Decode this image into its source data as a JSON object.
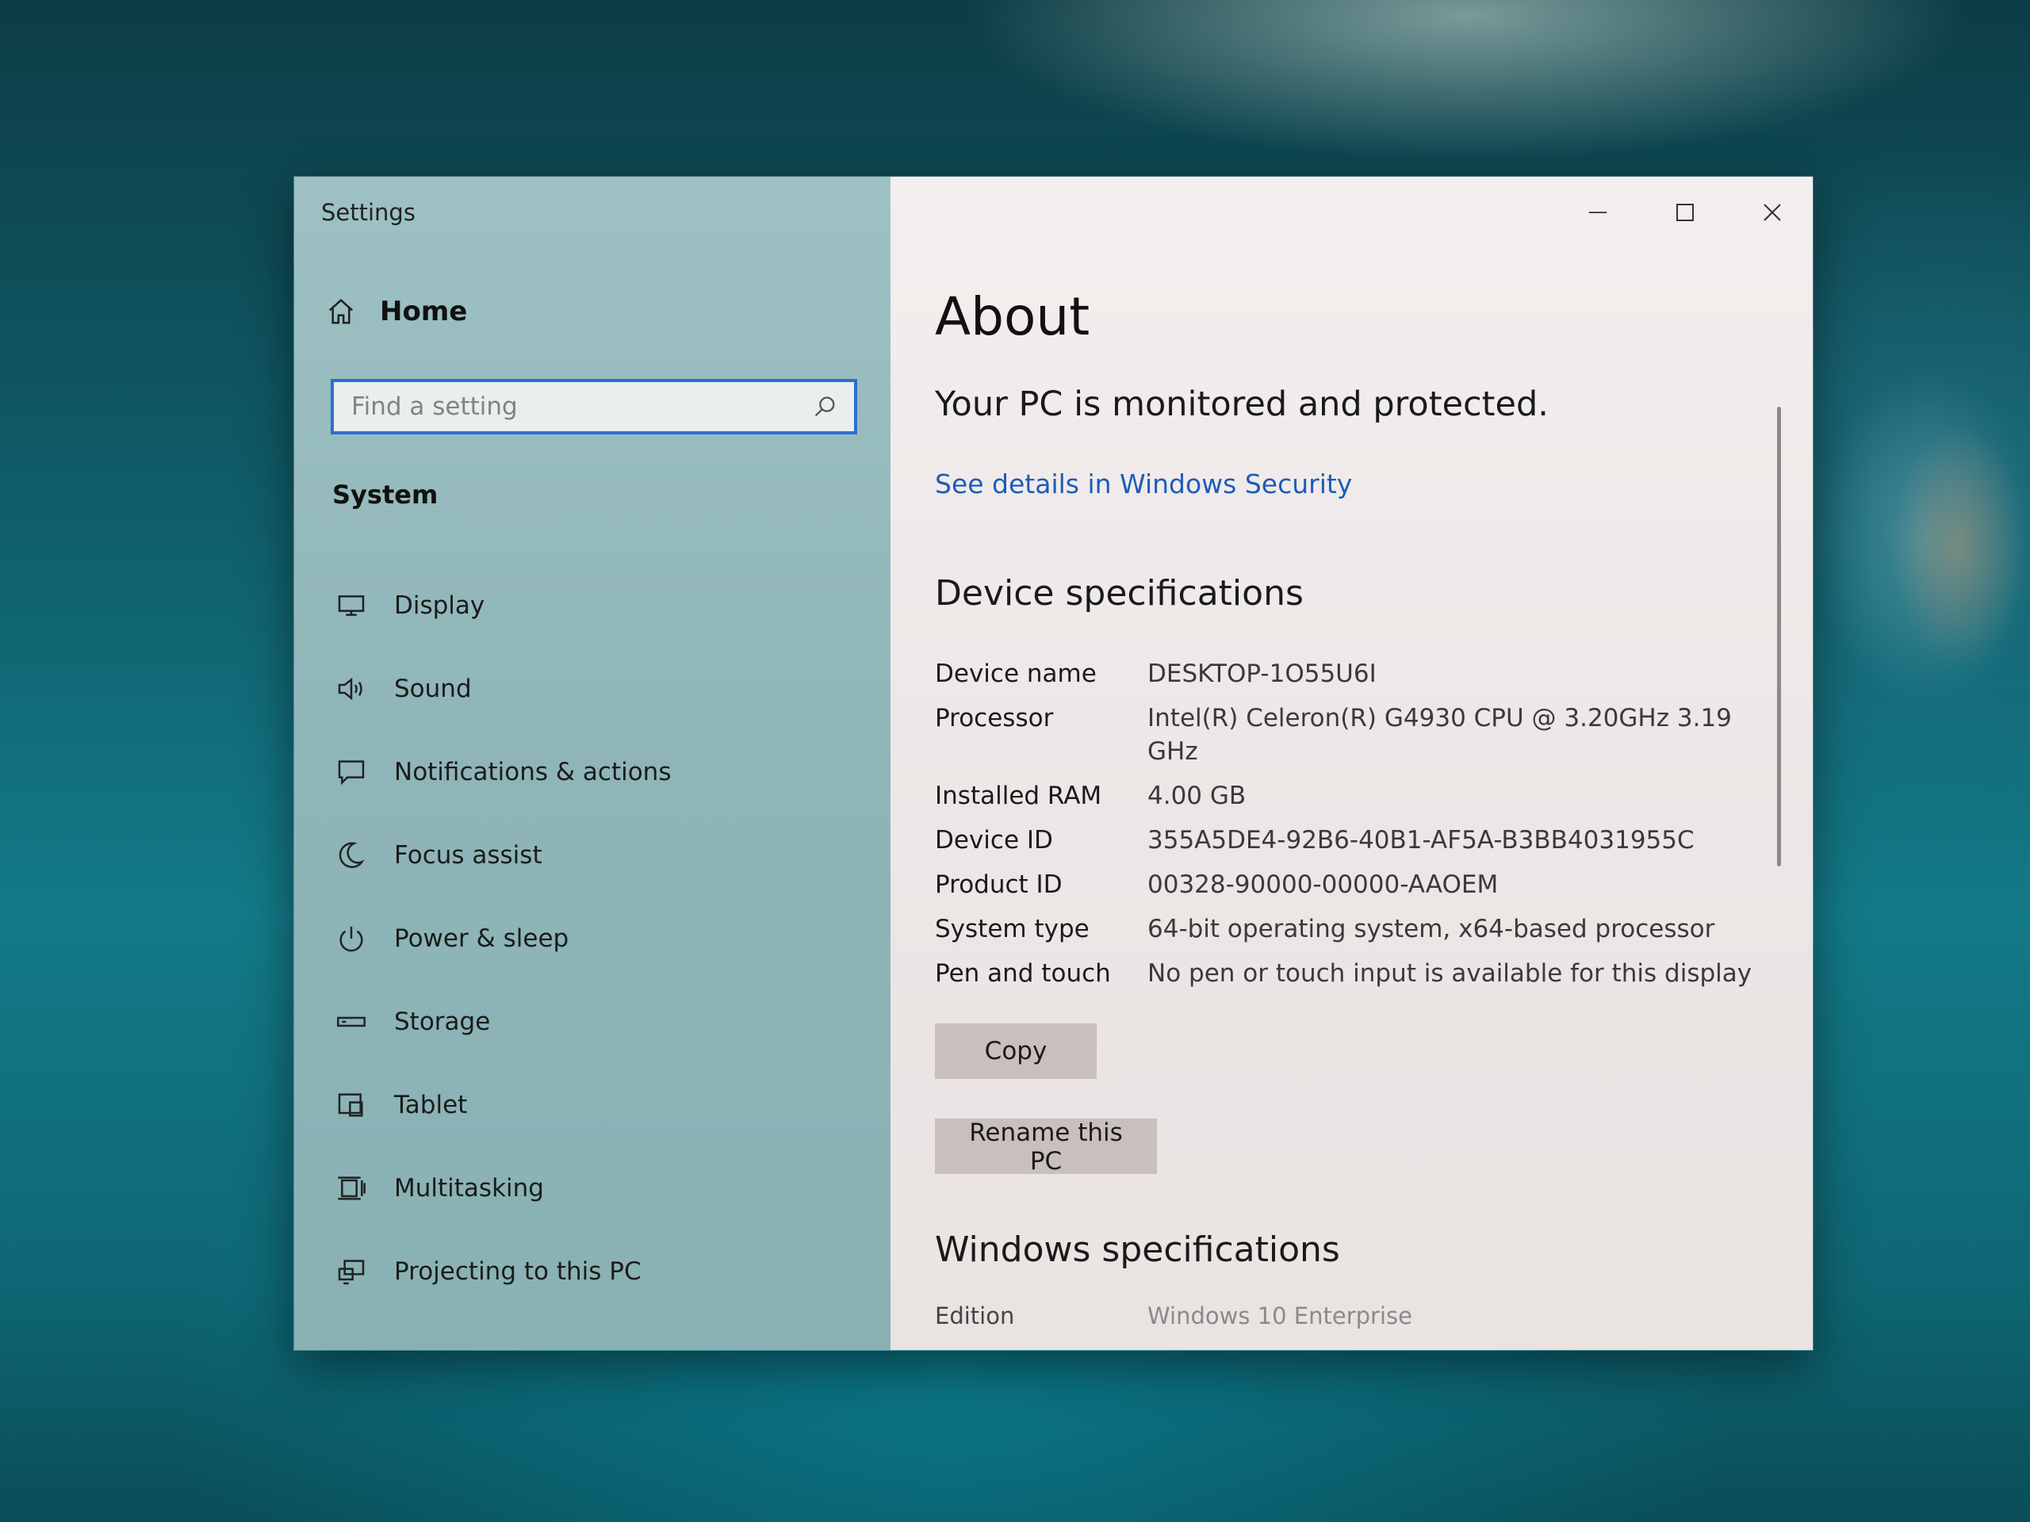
{
  "window": {
    "app_title": "Settings"
  },
  "sidebar": {
    "home_label": "Home",
    "search": {
      "placeholder": "Find a setting",
      "value": ""
    },
    "section_title": "System",
    "items": [
      {
        "label": "Display",
        "icon": "display-icon"
      },
      {
        "label": "Sound",
        "icon": "speaker-icon"
      },
      {
        "label": "Notifications & actions",
        "icon": "notification-icon"
      },
      {
        "label": "Focus assist",
        "icon": "moon-icon"
      },
      {
        "label": "Power & sleep",
        "icon": "power-icon"
      },
      {
        "label": "Storage",
        "icon": "storage-icon"
      },
      {
        "label": "Tablet",
        "icon": "tablet-icon"
      },
      {
        "label": "Multitasking",
        "icon": "multitasking-icon"
      },
      {
        "label": "Projecting to this PC",
        "icon": "projecting-icon"
      }
    ]
  },
  "main": {
    "title": "About",
    "protection_message": "Your PC is monitored and protected.",
    "security_link": "See details in Windows Security",
    "device_specs_heading": "Device specifications",
    "device_specs": [
      {
        "label": "Device name",
        "value": "DESKTOP-1O55U6I"
      },
      {
        "label": "Processor",
        "value": "Intel(R) Celeron(R) G4930 CPU @ 3.20GHz   3.19 GHz"
      },
      {
        "label": "Installed RAM",
        "value": "4.00 GB"
      },
      {
        "label": "Device ID",
        "value": "355A5DE4-92B6-40B1-AF5A-B3BB4031955C"
      },
      {
        "label": "Product ID",
        "value": "00328-90000-00000-AAOEM"
      },
      {
        "label": "System type",
        "value": "64-bit operating system, x64-based processor"
      },
      {
        "label": "Pen and touch",
        "value": "No pen or touch input is available for this display"
      }
    ],
    "copy_button": "Copy",
    "rename_button": "Rename this PC",
    "windows_specs_heading": "Windows specifications",
    "edition": {
      "label": "Edition",
      "value": "Windows 10 Enterprise"
    }
  },
  "colors": {
    "sidebar_bg": "#8fb5b8",
    "content_bg": "#ece7e6",
    "link": "#1d5cb8",
    "search_border": "#2d6ed3",
    "button_bg": "#c9bfbf"
  }
}
